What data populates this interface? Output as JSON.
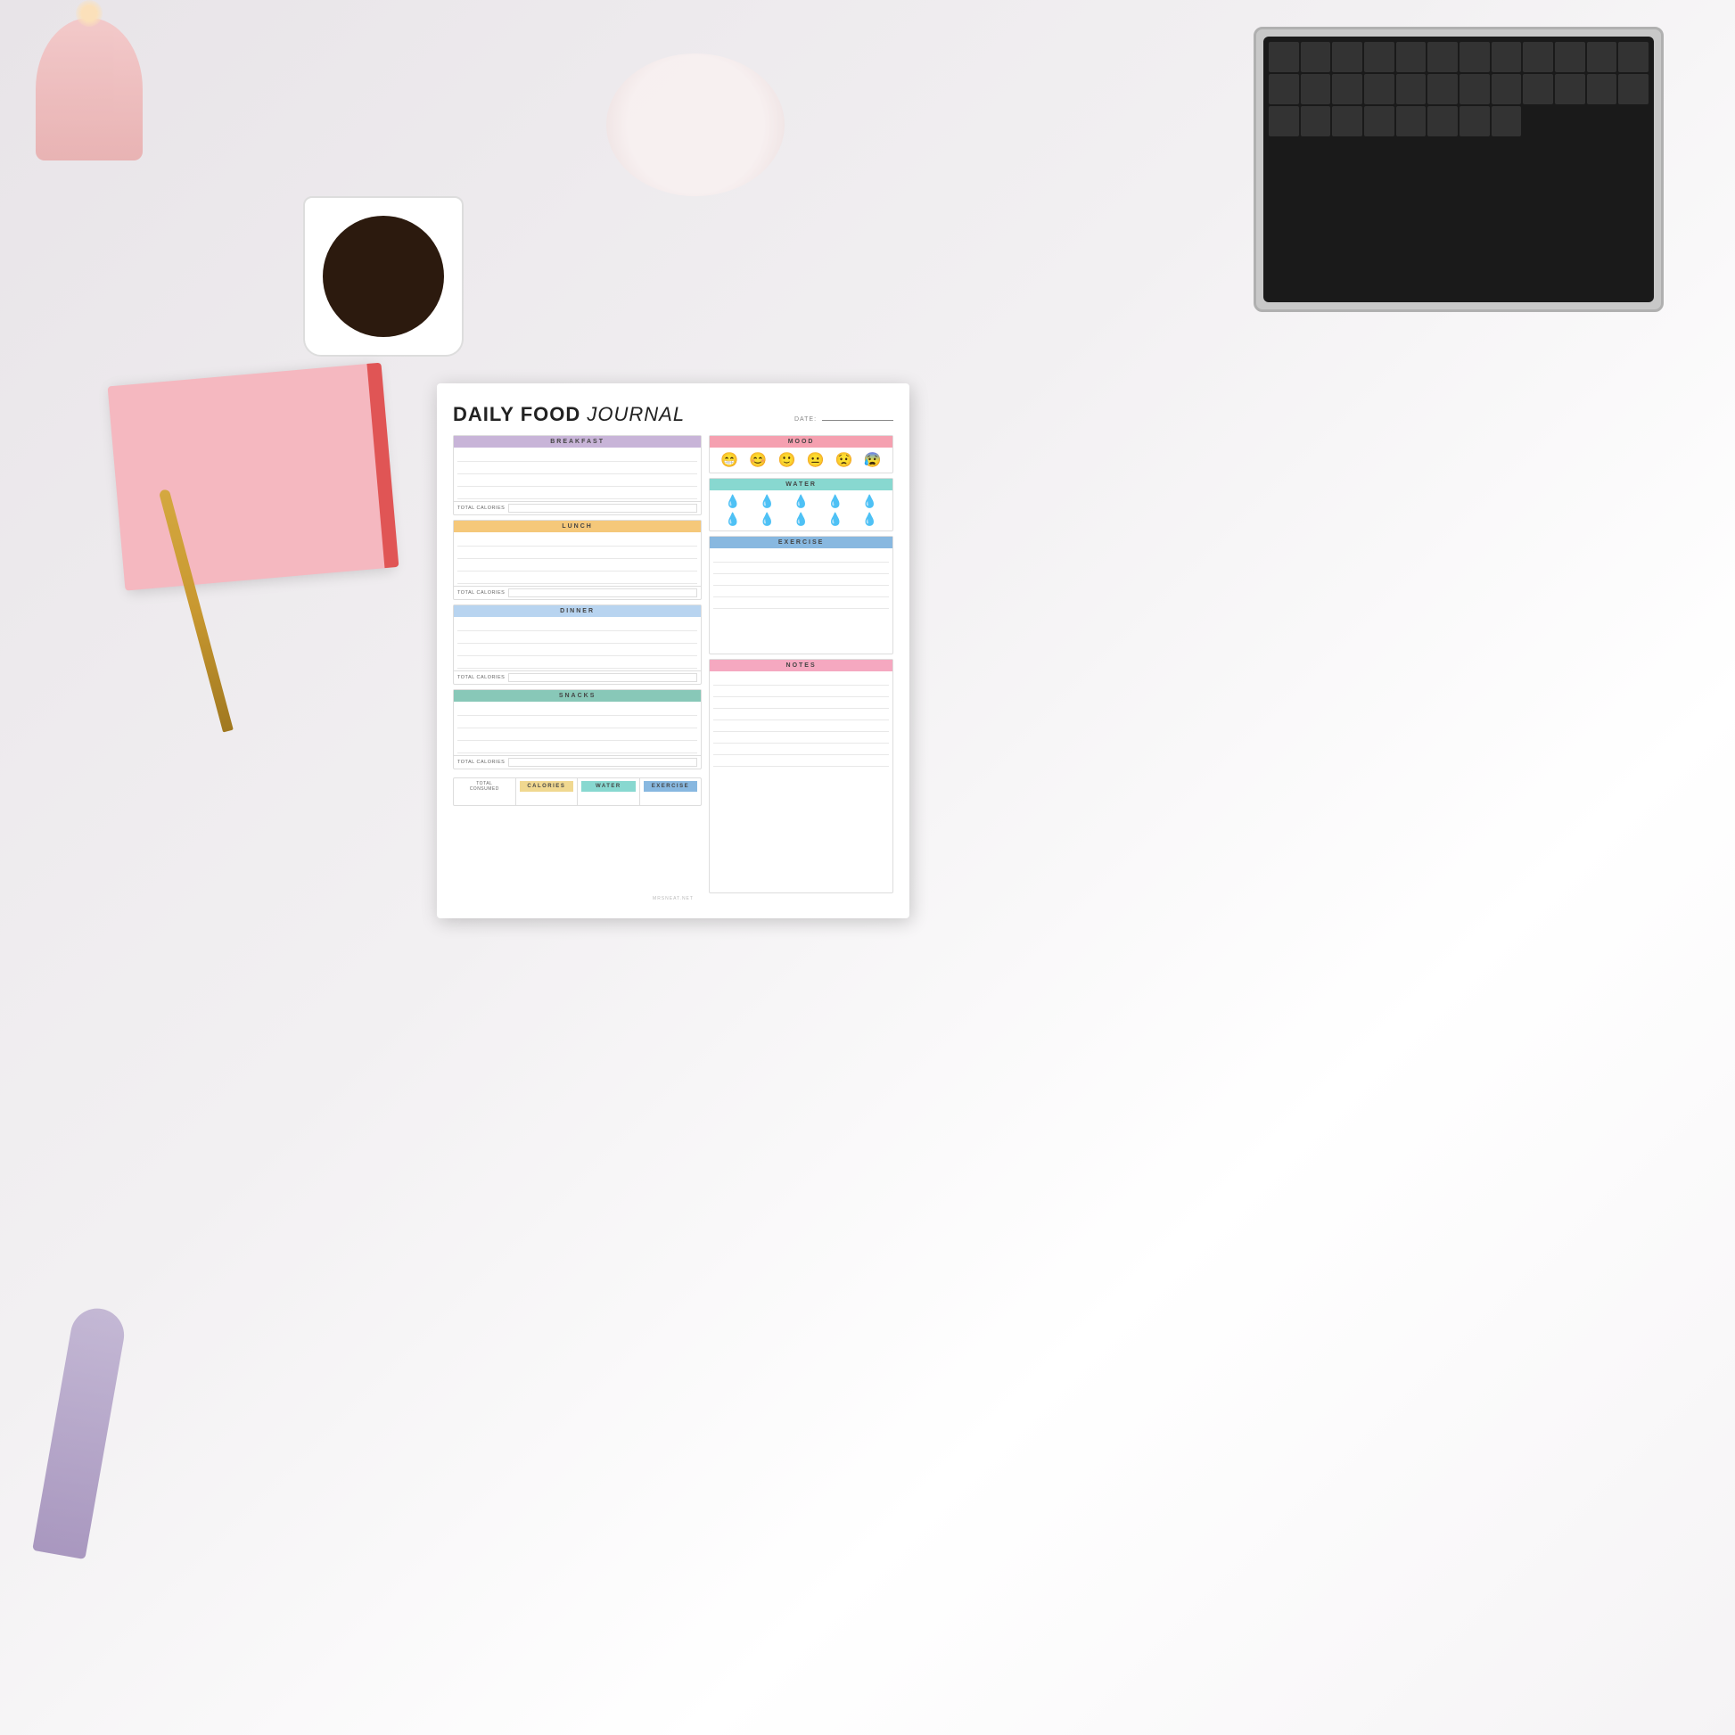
{
  "title": "DAILY FOOD",
  "titleThin": "JOURNAL",
  "dateLabel": "DATE:",
  "sections": {
    "breakfast": {
      "header": "BREAKFAST",
      "totalCalLabel": "TOTAL CALORIES",
      "lines": 4
    },
    "lunch": {
      "header": "LUNCH",
      "totalCalLabel": "TOTAL CALORIES",
      "lines": 4
    },
    "dinner": {
      "header": "DINNER",
      "totalCalLabel": "TOTAL CALORIES",
      "lines": 4
    },
    "snacks": {
      "header": "SNACKS",
      "totalCalLabel": "TOTAL CALORIES",
      "lines": 4
    }
  },
  "right": {
    "mood": {
      "header": "MOOD",
      "emojis": [
        "😁",
        "😊",
        "🙂",
        "😐",
        "😟",
        "😰"
      ]
    },
    "water": {
      "header": "WATER",
      "dropCount": 10
    },
    "exercise": {
      "header": "EXERCISE",
      "lines": 5
    },
    "notes": {
      "header": "NOTES",
      "lines": 8
    }
  },
  "summary": {
    "totalConsumedLabel": "TOTAL\nCONSUMED",
    "caloriesLabel": "CALORIES",
    "waterLabel": "WATER",
    "exerciseLabel": "EXERCISE"
  },
  "website": "MRSNEAT.NET"
}
